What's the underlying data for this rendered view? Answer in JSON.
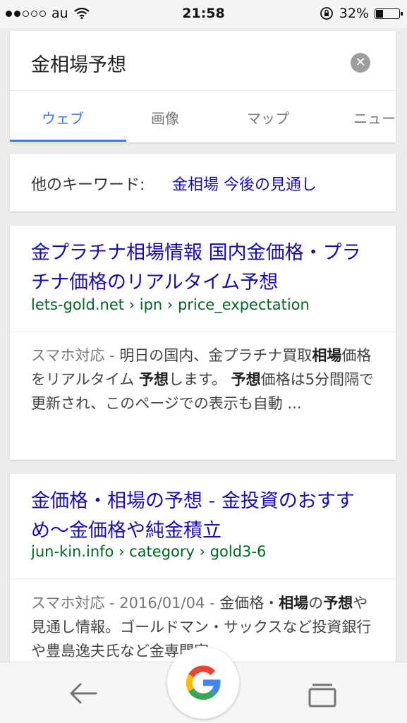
{
  "status": {
    "carrier": "au",
    "time": "21:58",
    "battery_percent": "32%",
    "battery_level": 0.32,
    "signal_bars_filled": 2,
    "icons": [
      "wifi-icon",
      "orientation-lock-icon",
      "battery-icon"
    ]
  },
  "search": {
    "query": "金相場予想",
    "clear_icon": "clear-icon"
  },
  "tabs": [
    {
      "label": "ウェブ",
      "active": true
    },
    {
      "label": "画像",
      "active": false
    },
    {
      "label": "マップ",
      "active": false
    },
    {
      "label": "ニュー",
      "active": false
    }
  ],
  "related": {
    "label": "他のキーワード:",
    "link": "金相場 今後の見通し"
  },
  "results": [
    {
      "title": "金プラチナ相場情報 国内金価格・プラチナ価格のリアルタイム予想",
      "url": "lets-gold.net › ipn › price_expectation",
      "snippet_prefix": "スマホ対応 - ",
      "snippet_parts": [
        {
          "t": "明日の国内、金プラチナ買取"
        },
        {
          "t": "相場",
          "b": true
        },
        {
          "t": "価格をリアルタイム "
        },
        {
          "t": "予想",
          "b": true
        },
        {
          "t": "します。 "
        },
        {
          "t": "予想",
          "b": true
        },
        {
          "t": "価格は5分間隔で更新され、このページでの表示も自動 ..."
        }
      ]
    },
    {
      "title": "金価格・相場の予想 - 金投資のおすすめ〜金価格や純金積立",
      "url": "jun-kin.info › category › gold3-6",
      "snippet_prefix": "スマホ対応 - 2016/01/04 - ",
      "snippet_parts": [
        {
          "t": "金価格・"
        },
        {
          "t": "相場",
          "b": true
        },
        {
          "t": "の"
        },
        {
          "t": "予想",
          "b": true
        },
        {
          "t": "や見通し情報。ゴールドマン・サックスなど投資銀行や豊島逸夫氏など金専門家"
        }
      ]
    }
  ],
  "bottom_bar": {
    "back_icon": "back-arrow-icon",
    "home_icon": "google-g-icon",
    "tabs_icon": "tabs-icon"
  }
}
